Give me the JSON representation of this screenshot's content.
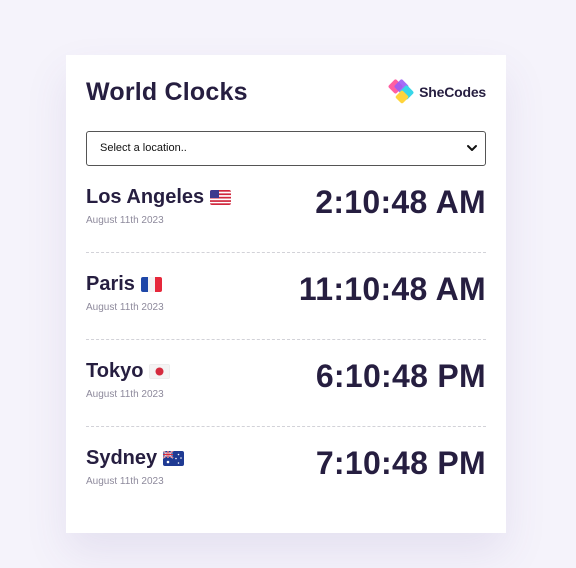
{
  "header": {
    "title": "World Clocks",
    "logo_text": "SheCodes"
  },
  "location_select": {
    "selected": "Select a location.."
  },
  "cities": [
    {
      "name": "Los Angeles",
      "flag": "us-flag-icon",
      "date": "August 11th 2023",
      "time": "2:10:48 AM"
    },
    {
      "name": "Paris",
      "flag": "france-flag-icon",
      "date": "August 11th 2023",
      "time": "11:10:48 AM"
    },
    {
      "name": "Tokyo",
      "flag": "japan-flag-icon",
      "date": "August 11th 2023",
      "time": "6:10:48 PM"
    },
    {
      "name": "Sydney",
      "flag": "australia-flag-icon",
      "date": "August 11th 2023",
      "time": "7:10:48 PM"
    }
  ],
  "colors": {
    "background": "#f5f3fb",
    "card": "#ffffff",
    "text_primary": "#261e40",
    "text_muted": "#8e8a9c",
    "logo_pink": "#ff5fa2",
    "logo_purple": "#9b5cf6",
    "logo_cyan": "#38d6e8",
    "logo_yellow": "#ffd43b"
  }
}
